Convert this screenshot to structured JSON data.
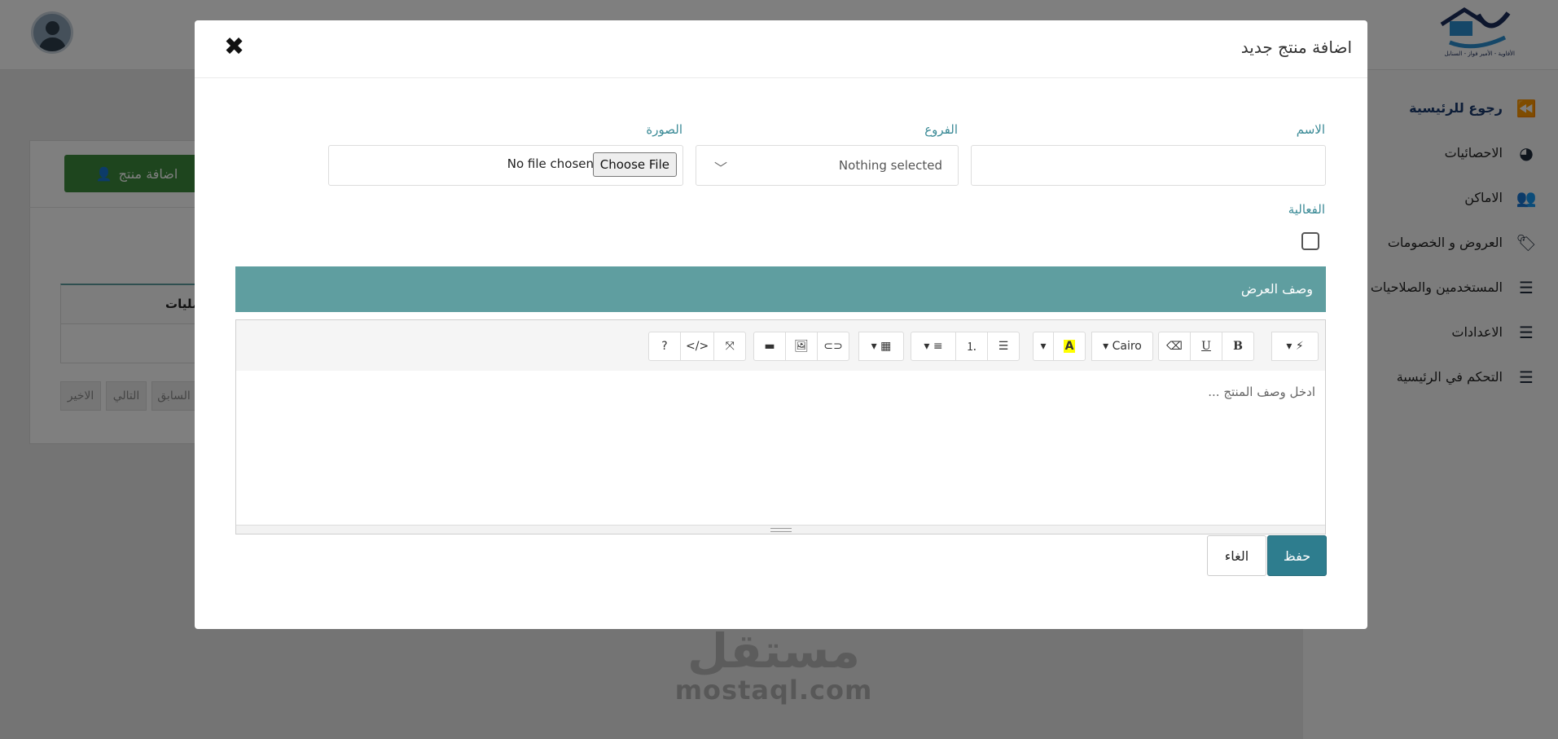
{
  "topbar": {
    "logo_caption": "الأفاوية - الأمير فواز - السنابل"
  },
  "sidebar": {
    "items": [
      {
        "label": "رجوع للرئيسية",
        "icon": "double-chevron-left-icon"
      },
      {
        "label": "الاحصائيات",
        "icon": "pie-chart-icon"
      },
      {
        "label": "الاماكن",
        "icon": "users-icon"
      },
      {
        "label": "العروض و الخصومات",
        "icon": "tags-icon"
      },
      {
        "label": "المستخدمين والصلاحيات",
        "icon": "list-icon"
      },
      {
        "label": "الاعدادات",
        "icon": "list-icon"
      },
      {
        "label": "التحكم في الرئيسية",
        "icon": "list-icon"
      }
    ]
  },
  "background": {
    "add_product_label": "اضافة منتج",
    "ops_header": "مليات",
    "pager": {
      "last": "الاخير",
      "next": "التالي",
      "prev": "السابق"
    }
  },
  "watermark": {
    "arabic": "مستقل",
    "latin": "mostaql.com"
  },
  "modal": {
    "title": "اضافة منتج جديد",
    "close_glyph": "✖",
    "name_label": "الاسم",
    "branches_label": "الفروع",
    "branches_value": "Nothing selected",
    "image_label": "الصورة",
    "file_button": "Choose File",
    "file_status": "No file chosen",
    "active_label": "الفعالية",
    "active_checked": false,
    "section_title": "وصف العرض",
    "editor_placeholder": "ادخل وصف المنتج ...",
    "toolbar": {
      "font_name": "Cairo",
      "bold": "B",
      "underline": "U",
      "highlight": "A",
      "help": "?",
      "code": "</>"
    },
    "save_label": "حفظ",
    "cancel_label": "الغاء"
  },
  "colors": {
    "accent": "#5f9ea0",
    "primary_button": "#2e7d8e",
    "label": "#3a8a96",
    "success": "#3c8b3c"
  }
}
